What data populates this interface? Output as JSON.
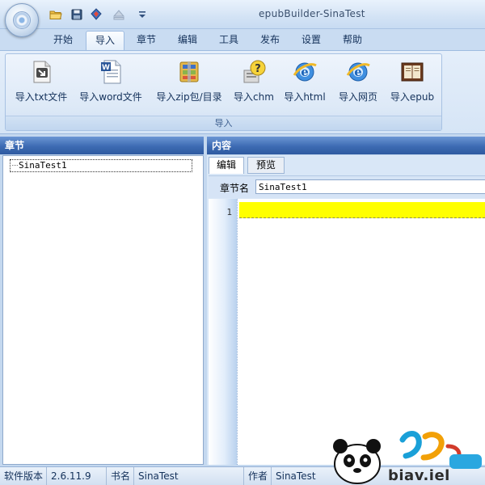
{
  "window": {
    "title": "epubBuilder-SinaTest"
  },
  "quick_access": [
    {
      "name": "open-folder-icon"
    },
    {
      "name": "save-icon"
    },
    {
      "name": "build-icon"
    },
    {
      "name": "eject-icon"
    },
    {
      "name": "customize-dropdown-icon"
    }
  ],
  "ribbon": {
    "tabs": [
      "开始",
      "导入",
      "章节",
      "编辑",
      "工具",
      "发布",
      "设置",
      "帮助"
    ],
    "active_tab": "导入",
    "group": {
      "caption": "导入",
      "buttons": [
        {
          "label": "导入txt文件",
          "icon": "txt-import-icon"
        },
        {
          "label": "导入word文件",
          "icon": "word-document-icon"
        },
        {
          "label": "导入zip包/目录",
          "icon": "zip-archive-icon"
        },
        {
          "label": "导入chm",
          "icon": "chm-help-icon"
        },
        {
          "label": "导入html",
          "icon": "internet-explorer-icon"
        },
        {
          "label": "导入网页",
          "icon": "internet-explorer-icon"
        },
        {
          "label": "导入epub",
          "icon": "epub-book-icon"
        }
      ]
    }
  },
  "left_pane": {
    "header": "章节",
    "tree": [
      {
        "label": "SinaTest1"
      }
    ]
  },
  "right_pane": {
    "header": "内容",
    "tabs": [
      "编辑",
      "预览"
    ],
    "active_tab": "编辑",
    "chapter_name_label": "章节名",
    "chapter_name_value": "SinaTest1",
    "editor": {
      "line_numbers": [
        "1"
      ],
      "highlight_color": "#ffff00"
    }
  },
  "statusbar": {
    "version_label": "软件版本",
    "version_value": "2.6.11.9",
    "bookname_label": "书名",
    "bookname_value": "SinaTest",
    "author_label": "作者",
    "author_value": "SinaTest"
  },
  "watermark": {
    "url_text": "biav.iel"
  },
  "colors": {
    "pane_header": "#3d6bb3",
    "ribbon_bg": "#dde9f7",
    "current_line": "#ffff00"
  }
}
